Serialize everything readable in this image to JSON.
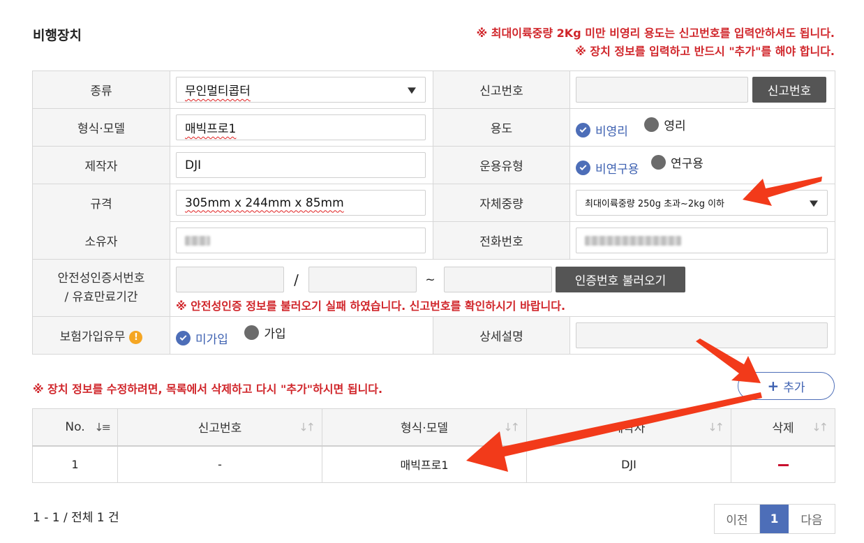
{
  "section_title": "비행장치",
  "notices": {
    "line1": "※ 최대이륙중량 2Kg 미만 비영리 용도는 신고번호를 입력안하셔도 됩니다.",
    "line2": "※ 장치 정보를 입력하고 반드시 \"추가\"를 해야 합니다."
  },
  "form": {
    "type_label": "종류",
    "type_value": "무인멀티콥터",
    "report_no_label": "신고번호",
    "report_no_value": "",
    "report_no_button": "신고번호",
    "model_label": "형식·모델",
    "model_value": "매빅프로1",
    "usage_label": "용도",
    "usage_options": [
      "비영리",
      "영리"
    ],
    "maker_label": "제작자",
    "maker_value": "DJI",
    "op_type_label": "운용유형",
    "op_type_options": [
      "비연구용",
      "연구용"
    ],
    "spec_label": "규격",
    "spec_value": "305mm x 244mm x 85mm",
    "weight_label": "자체중량",
    "weight_value": "최대이륙중량 250g 초과~2kg 이하",
    "owner_label": "소유자",
    "phone_label": "전화번호",
    "cert_label_line1": "안전성인증서번호",
    "cert_label_line2": "/ 유효만료기간",
    "cert_separator_slash": "/",
    "cert_separator_tilde": "~",
    "cert_button": "인증번호 불러오기",
    "cert_error": "※ 안전성인증 정보를 불러오기 실패 하였습니다. 신고번호를 확인하시기 바랍니다.",
    "insurance_label": "보험가입유무",
    "insurance_options": [
      "미가입",
      "가입"
    ],
    "detail_label": "상세설명",
    "detail_value": ""
  },
  "edit_notice": "※ 장치 정보를 수정하려면, 목록에서 삭제하고 다시 \"추가\"하시면 됩니다.",
  "add_button": "추가",
  "list": {
    "headers": [
      "No.",
      "신고번호",
      "형식·모델",
      "제작자",
      "삭제"
    ],
    "rows": [
      {
        "no": "1",
        "report_no": "-",
        "model": "매빅프로1",
        "maker": "DJI"
      }
    ]
  },
  "pagination": {
    "summary": "1 - 1 / 전체 1 건",
    "prev": "이전",
    "current": "1",
    "next": "다음"
  },
  "colors": {
    "accent": "#4d6eb8",
    "warning": "#d0252a",
    "arrow": "#f23a1a"
  }
}
